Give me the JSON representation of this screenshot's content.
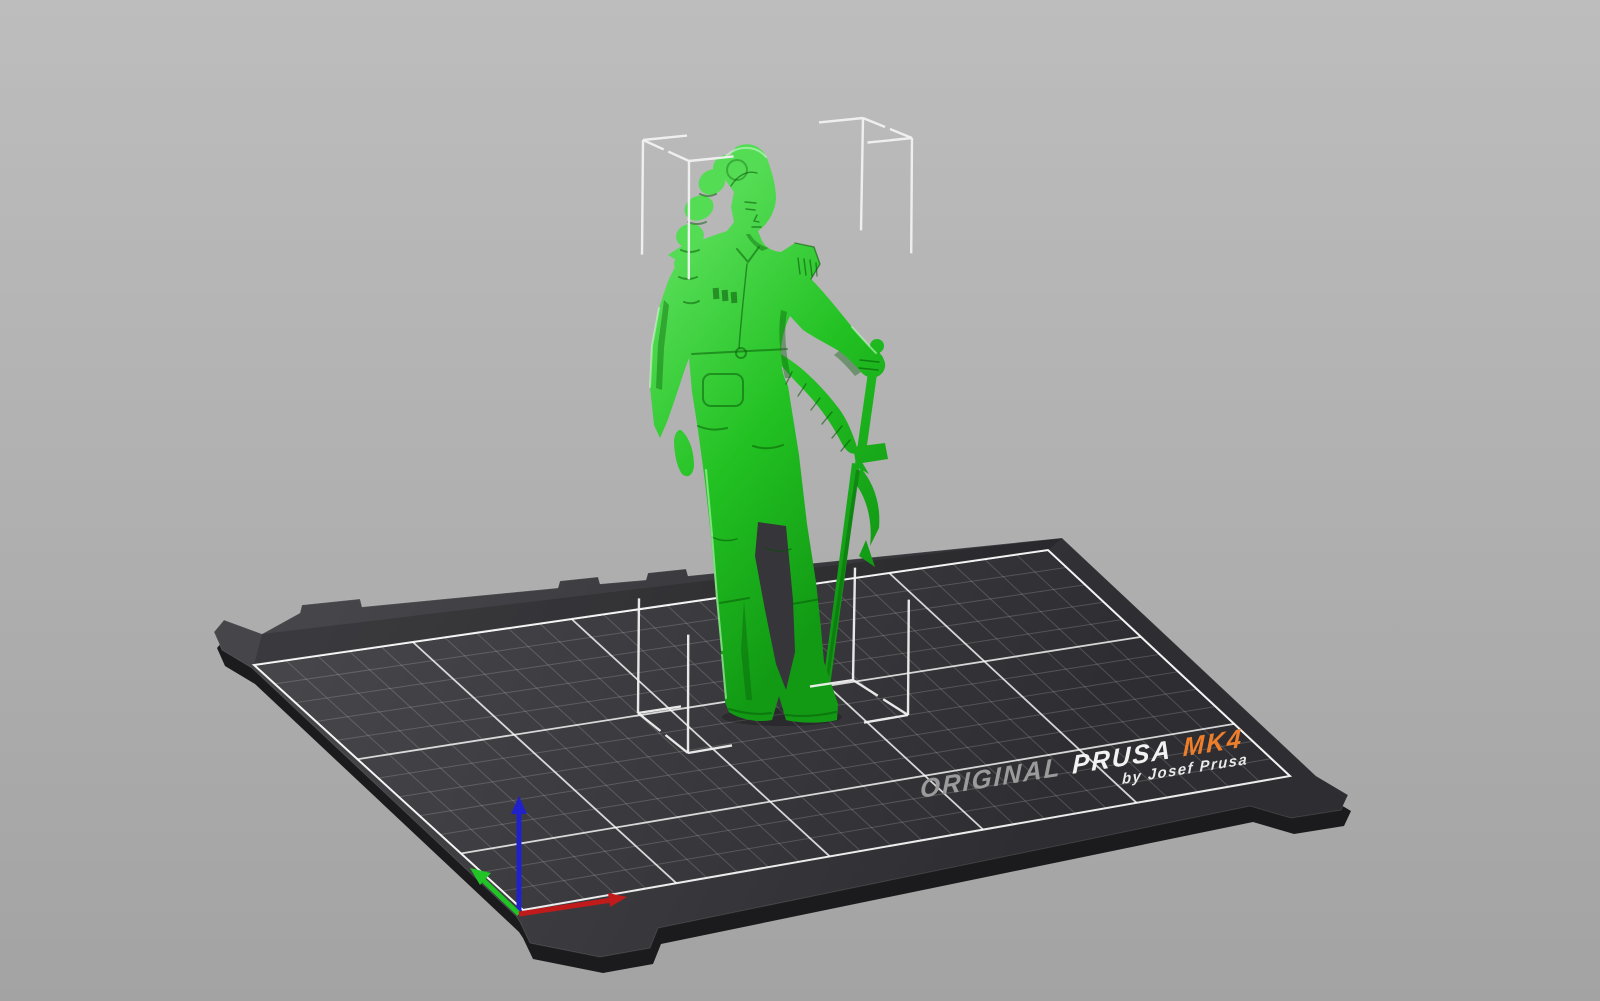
{
  "viewport": {
    "background_top": "#bdbdbd",
    "background_bottom": "#a3a3a3"
  },
  "bed": {
    "brand": {
      "prefix": "ORIGINAL",
      "name": "PRUSA",
      "model": "MK4",
      "byline": "by Josef Prusa",
      "prefix_color": "#9b9b9b",
      "name_color": "#f2f2f2",
      "model_color": "#ef7e2a",
      "byline_color": "#e9e9e9"
    },
    "surface_color_back": "#46464a",
    "surface_color_front": "#2e2e32",
    "underside_color": "#1b1b1d",
    "grid_minor_color": "rgba(255,255,255,0.17)",
    "grid_major_color": "rgba(255,255,255,0.8)",
    "print_area_border_color": "rgba(255,255,255,0.9)"
  },
  "origin_axes": {
    "x_color": "#c11a1a",
    "y_color": "#21c326",
    "z_color": "#2121cc"
  },
  "model": {
    "name": "figurine",
    "base_color": "#22c122",
    "highlight_color": "#55dc55",
    "shadow_color": "#129a14"
  },
  "selection_box": {
    "line_color": "#f2f2f2"
  }
}
